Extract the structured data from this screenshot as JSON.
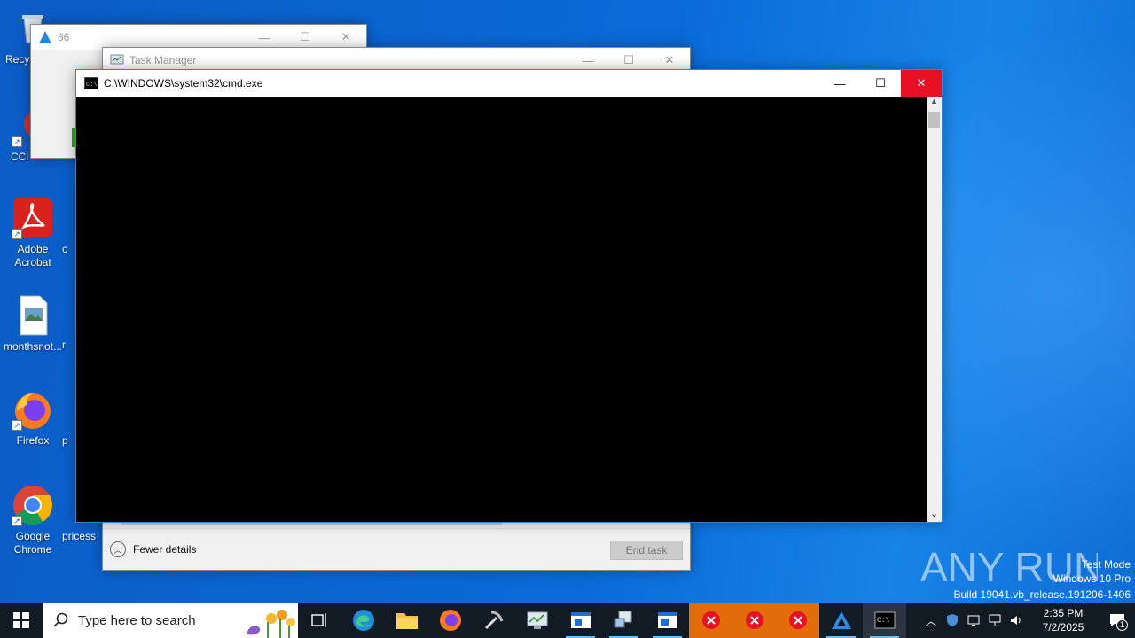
{
  "desktop": {
    "icons": [
      {
        "label": "Recy",
        "icon": "recycle-bin-icon"
      },
      {
        "label": "CCl",
        "icon": "ccleaner-icon"
      },
      {
        "label": "Adobe Acrobat",
        "icon": "adobe-acrobat-icon"
      },
      {
        "label": "monthsnot...",
        "icon": "image-file-icon"
      },
      {
        "label": "Firefox",
        "icon": "firefox-icon"
      },
      {
        "label": "Google Chrome",
        "icon": "chrome-icon"
      },
      {
        "label": "c",
        "icon": "file-icon"
      },
      {
        "label": "r",
        "icon": "file-icon"
      },
      {
        "label": "p",
        "icon": "file-icon"
      },
      {
        "label": "pricess",
        "icon": "file-icon"
      }
    ],
    "watermark": {
      "brand": "ANY RUN",
      "mode": "Test Mode",
      "edition": "Windows 10 Pro",
      "build": "Build 19041.vb_release.191206-1406"
    }
  },
  "windows": {
    "app36": {
      "title": "36"
    },
    "task_manager": {
      "title": "Task Manager",
      "fewer_details": "Fewer details",
      "end_task": "End task"
    },
    "cmd": {
      "title": "C:\\WINDOWS\\system32\\cmd.exe"
    }
  },
  "taskbar": {
    "search_placeholder": "Type here to search",
    "clock_time": "2:35 PM",
    "clock_date": "7/2/2025",
    "notification_count": "1",
    "accent": "#e36c0a"
  }
}
